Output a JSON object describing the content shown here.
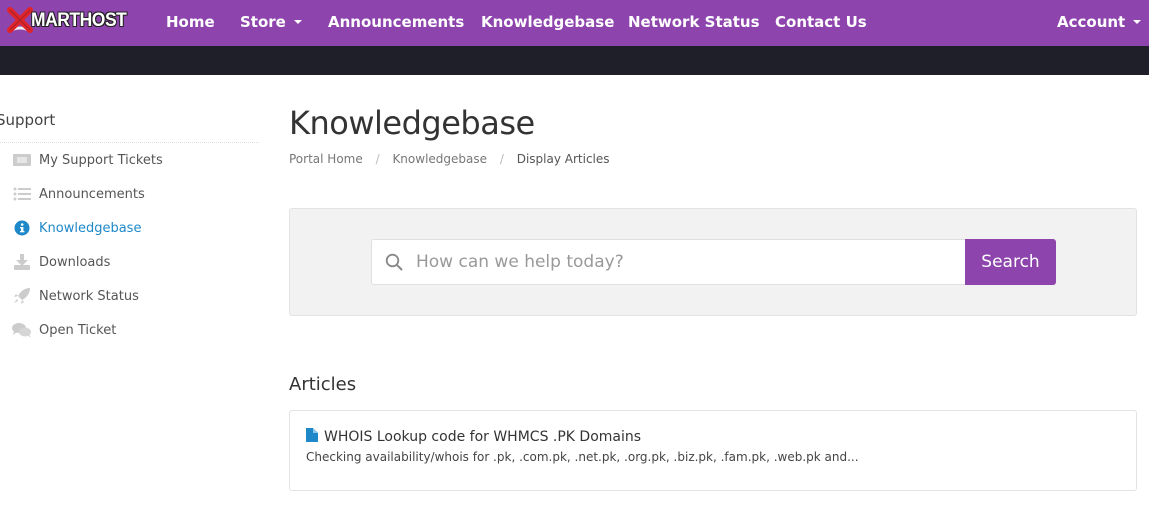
{
  "brand": {
    "name": "MARTHOST",
    "accent": "#8e44ad",
    "link_color": "#1e88c8"
  },
  "nav": {
    "items": [
      {
        "label": "Home",
        "dropdown": false
      },
      {
        "label": "Store",
        "dropdown": true
      },
      {
        "label": "Announcements",
        "dropdown": false
      },
      {
        "label": "Knowledgebase",
        "dropdown": false
      },
      {
        "label": "Network Status",
        "dropdown": false
      },
      {
        "label": "Contact Us",
        "dropdown": false
      }
    ],
    "account": {
      "label": "Account",
      "dropdown": true
    }
  },
  "sidebar": {
    "title": "Support",
    "items": [
      {
        "label": "My Support Tickets",
        "icon": "ticket-icon",
        "active": false
      },
      {
        "label": "Announcements",
        "icon": "list-icon",
        "active": false
      },
      {
        "label": "Knowledgebase",
        "icon": "info-circle-icon",
        "active": true
      },
      {
        "label": "Downloads",
        "icon": "download-icon",
        "active": false
      },
      {
        "label": "Network Status",
        "icon": "rocket-icon",
        "active": false
      },
      {
        "label": "Open Ticket",
        "icon": "comments-icon",
        "active": false
      }
    ]
  },
  "main": {
    "title": "Knowledgebase",
    "breadcrumb": [
      {
        "label": "Portal Home",
        "link": true
      },
      {
        "label": "Knowledgebase",
        "link": true
      },
      {
        "label": "Display Articles",
        "link": false
      }
    ],
    "search": {
      "placeholder": "How can we help today?",
      "value": "",
      "button_label": "Search"
    },
    "articles_heading": "Articles",
    "articles": [
      {
        "title": "WHOIS Lookup code for WHMCS .PK Domains",
        "excerpt": "Checking availability/whois for .pk, .com.pk, .net.pk, .org.pk, .biz.pk, .fam.pk, .web.pk and..."
      }
    ]
  }
}
